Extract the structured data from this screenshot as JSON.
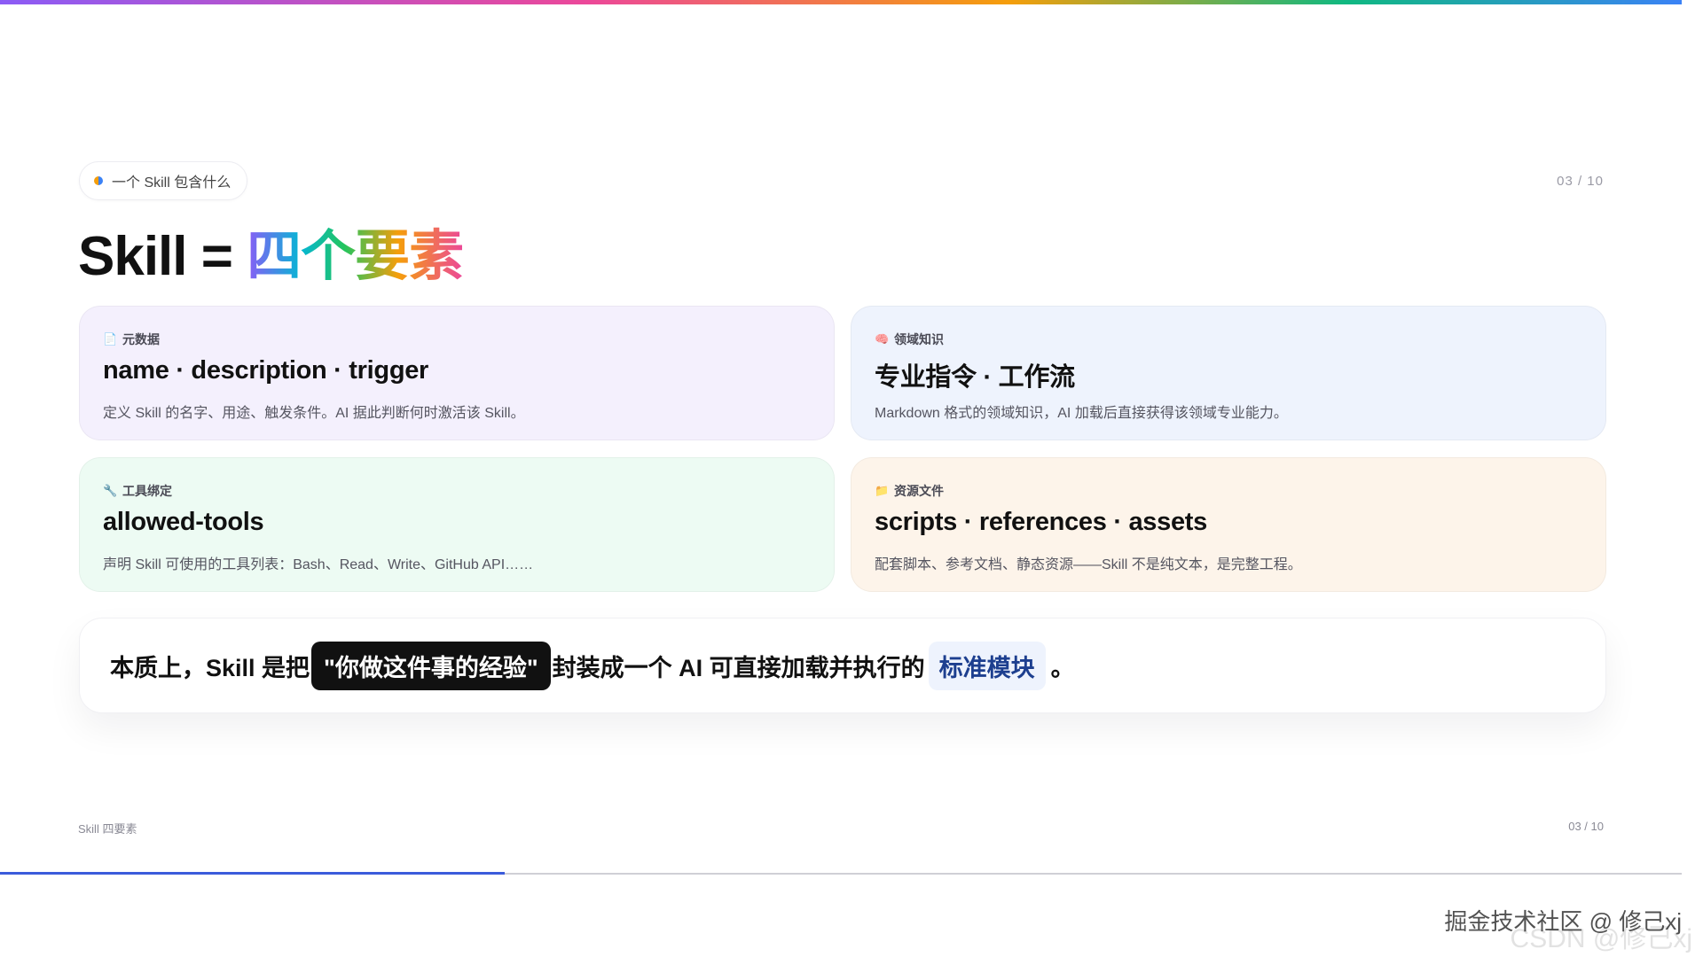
{
  "chip": {
    "label": "一个 Skill 包含什么"
  },
  "page_counter_top": "03  /  10",
  "headline": {
    "prefix": "Skill = ",
    "highlight": "四个要素"
  },
  "cards": [
    {
      "icon": "memo-icon",
      "glyph": "📄",
      "tag": "元数据",
      "title": "name · description · trigger",
      "desc": "定义 Skill 的名字、用途、触发条件。AI 据此判断何时激活该 Skill。"
    },
    {
      "icon": "brain-icon",
      "glyph": "🧠",
      "tag": "领域知识",
      "title": "专业指令 · 工作流",
      "desc": "Markdown 格式的领域知识，AI 加载后直接获得该领域专业能力。"
    },
    {
      "icon": "wrench-icon",
      "glyph": "🔧",
      "tag": "工具绑定",
      "title": "allowed-tools",
      "desc": "声明 Skill 可使用的工具列表：Bash、Read、Write、GitHub API……"
    },
    {
      "icon": "folder-icon",
      "glyph": "📁",
      "tag": "资源文件",
      "title": "scripts · references · assets",
      "desc": "配套脚本、参考文档、静态资源——Skill 不是纯文本，是完整工程。"
    }
  ],
  "summary": {
    "part1": "本质上，Skill 是把",
    "highlight_dark": "\"你做这件事的经验\"",
    "part2": "封装成一个 AI 可直接加载并执行的",
    "highlight_blue": "标准模块",
    "part3": "。"
  },
  "footer": {
    "left": "Skill 四要素",
    "right": "03 / 10"
  },
  "progress": {
    "fraction": 0.3
  },
  "watermark": {
    "line1": "掘金技术社区 @ 修己xj",
    "line2": "CSDN @修己xj"
  }
}
